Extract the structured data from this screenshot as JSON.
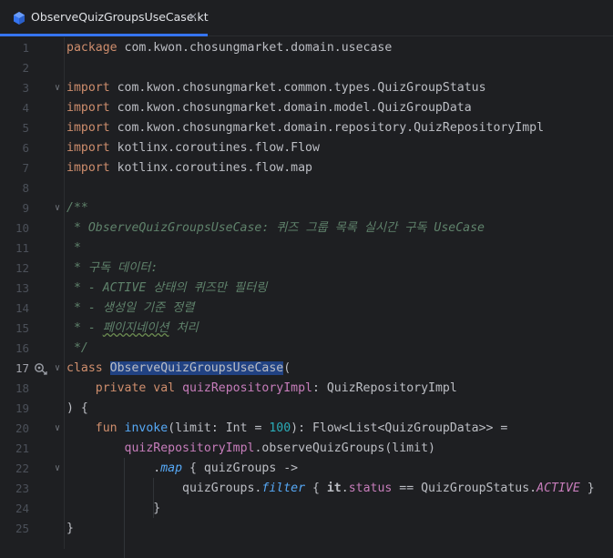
{
  "tab": {
    "filename": "ObserveQuizGroupsUseCase.kt",
    "close_glyph": "×",
    "icon": "kotlin-class-file-icon"
  },
  "editor": {
    "caret_line": 17,
    "lines": [
      {
        "n": "1",
        "fold": "",
        "segs": [
          [
            "kw",
            "package"
          ],
          [
            "",
            "com.kwon.chosungmarket.domain.usecase"
          ]
        ]
      },
      {
        "n": "2",
        "fold": "",
        "segs": []
      },
      {
        "n": "3",
        "fold": "v",
        "segs": [
          [
            "kw",
            "import"
          ],
          [
            "",
            "com.kwon.chosungmarket.common.types.QuizGroupStatus"
          ]
        ]
      },
      {
        "n": "4",
        "fold": "",
        "segs": [
          [
            "kw",
            "import"
          ],
          [
            "",
            "com.kwon.chosungmarket.domain.model.QuizGroupData"
          ]
        ]
      },
      {
        "n": "5",
        "fold": "",
        "segs": [
          [
            "kw",
            "import"
          ],
          [
            "",
            "com.kwon.chosungmarket.domain.repository.QuizRepositoryImpl"
          ]
        ]
      },
      {
        "n": "6",
        "fold": "",
        "segs": [
          [
            "kw",
            "import"
          ],
          [
            "",
            "kotlinx.coroutines.flow.Flow"
          ]
        ]
      },
      {
        "n": "7",
        "fold": "",
        "segs": [
          [
            "kw",
            "import"
          ],
          [
            "",
            "kotlinx.coroutines.flow.map"
          ]
        ]
      },
      {
        "n": "8",
        "fold": "",
        "segs": []
      },
      {
        "n": "9",
        "fold": "v",
        "segs": [
          [
            "cm",
            "/**"
          ]
        ]
      },
      {
        "n": "10",
        "fold": "",
        "segs": [
          [
            "cm",
            " * ObserveQuizGroupsUseCase: 퀴즈 그룹 목록 실시간 구독 UseCase"
          ]
        ]
      },
      {
        "n": "11",
        "fold": "",
        "segs": [
          [
            "cm",
            " *"
          ]
        ]
      },
      {
        "n": "12",
        "fold": "",
        "segs": [
          [
            "cm",
            " * 구독 데이터:"
          ]
        ]
      },
      {
        "n": "13",
        "fold": "",
        "segs": [
          [
            "cm",
            " * - ACTIVE 상태의 퀴즈만 필터링"
          ]
        ]
      },
      {
        "n": "14",
        "fold": "",
        "segs": [
          [
            "cm",
            " * - 생성일 기준 정렬"
          ]
        ]
      },
      {
        "n": "15",
        "fold": "",
        "segs": [
          [
            "cm",
            " * - "
          ],
          [
            "cm squig",
            "페이지네이션"
          ],
          [
            "cm",
            " 처리"
          ]
        ]
      },
      {
        "n": "16",
        "fold": "",
        "segs": [
          [
            "cm",
            " */"
          ]
        ]
      },
      {
        "n": "17",
        "fold": "v",
        "icon": true,
        "segs": [
          [
            "kw",
            "class"
          ],
          [
            "",
            " "
          ],
          [
            "sel",
            "ObserveQuizGroupsUseCase"
          ],
          [
            "",
            "("
          ]
        ]
      },
      {
        "n": "18",
        "fold": "",
        "segs": [
          [
            "",
            "    "
          ],
          [
            "kw",
            "private val"
          ],
          [
            "",
            " "
          ],
          [
            "prop",
            "quizRepositoryImpl"
          ],
          [
            "",
            ": QuizRepositoryImpl"
          ]
        ]
      },
      {
        "n": "19",
        "fold": "",
        "segs": [
          [
            "",
            ") {"
          ]
        ]
      },
      {
        "n": "20",
        "fold": "v",
        "segs": [
          [
            "",
            "    "
          ],
          [
            "kw",
            "fun"
          ],
          [
            "",
            " "
          ],
          [
            "fn",
            "invoke"
          ],
          [
            "",
            "(limit: Int = "
          ],
          [
            "num",
            "100"
          ],
          [
            "",
            "): Flow<List<QuizGroupData>> ="
          ]
        ]
      },
      {
        "n": "21",
        "fold": "",
        "segs": [
          [
            "",
            "        "
          ],
          [
            "prop",
            "quizRepositoryImpl"
          ],
          [
            "",
            ".observeQuizGroups(limit)"
          ]
        ]
      },
      {
        "n": "22",
        "fold": "v",
        "segs": [
          [
            "",
            "            ."
          ],
          [
            "fn ital",
            "map"
          ],
          [
            "",
            " { quizGroups ->"
          ]
        ]
      },
      {
        "n": "23",
        "fold": "",
        "segs": [
          [
            "",
            "                quizGroups."
          ],
          [
            "fn ital",
            "filter"
          ],
          [
            "",
            " { "
          ],
          [
            "itx",
            "it"
          ],
          [
            "",
            "."
          ],
          [
            "prop",
            "status"
          ],
          [
            "",
            " == QuizGroupStatus."
          ],
          [
            "prop ital",
            "ACTIVE"
          ],
          [
            "",
            " }"
          ]
        ]
      },
      {
        "n": "24",
        "fold": "",
        "segs": [
          [
            "",
            "            }"
          ]
        ]
      },
      {
        "n": "25",
        "fold": "",
        "segs": [
          [
            "",
            "}"
          ]
        ]
      }
    ]
  }
}
